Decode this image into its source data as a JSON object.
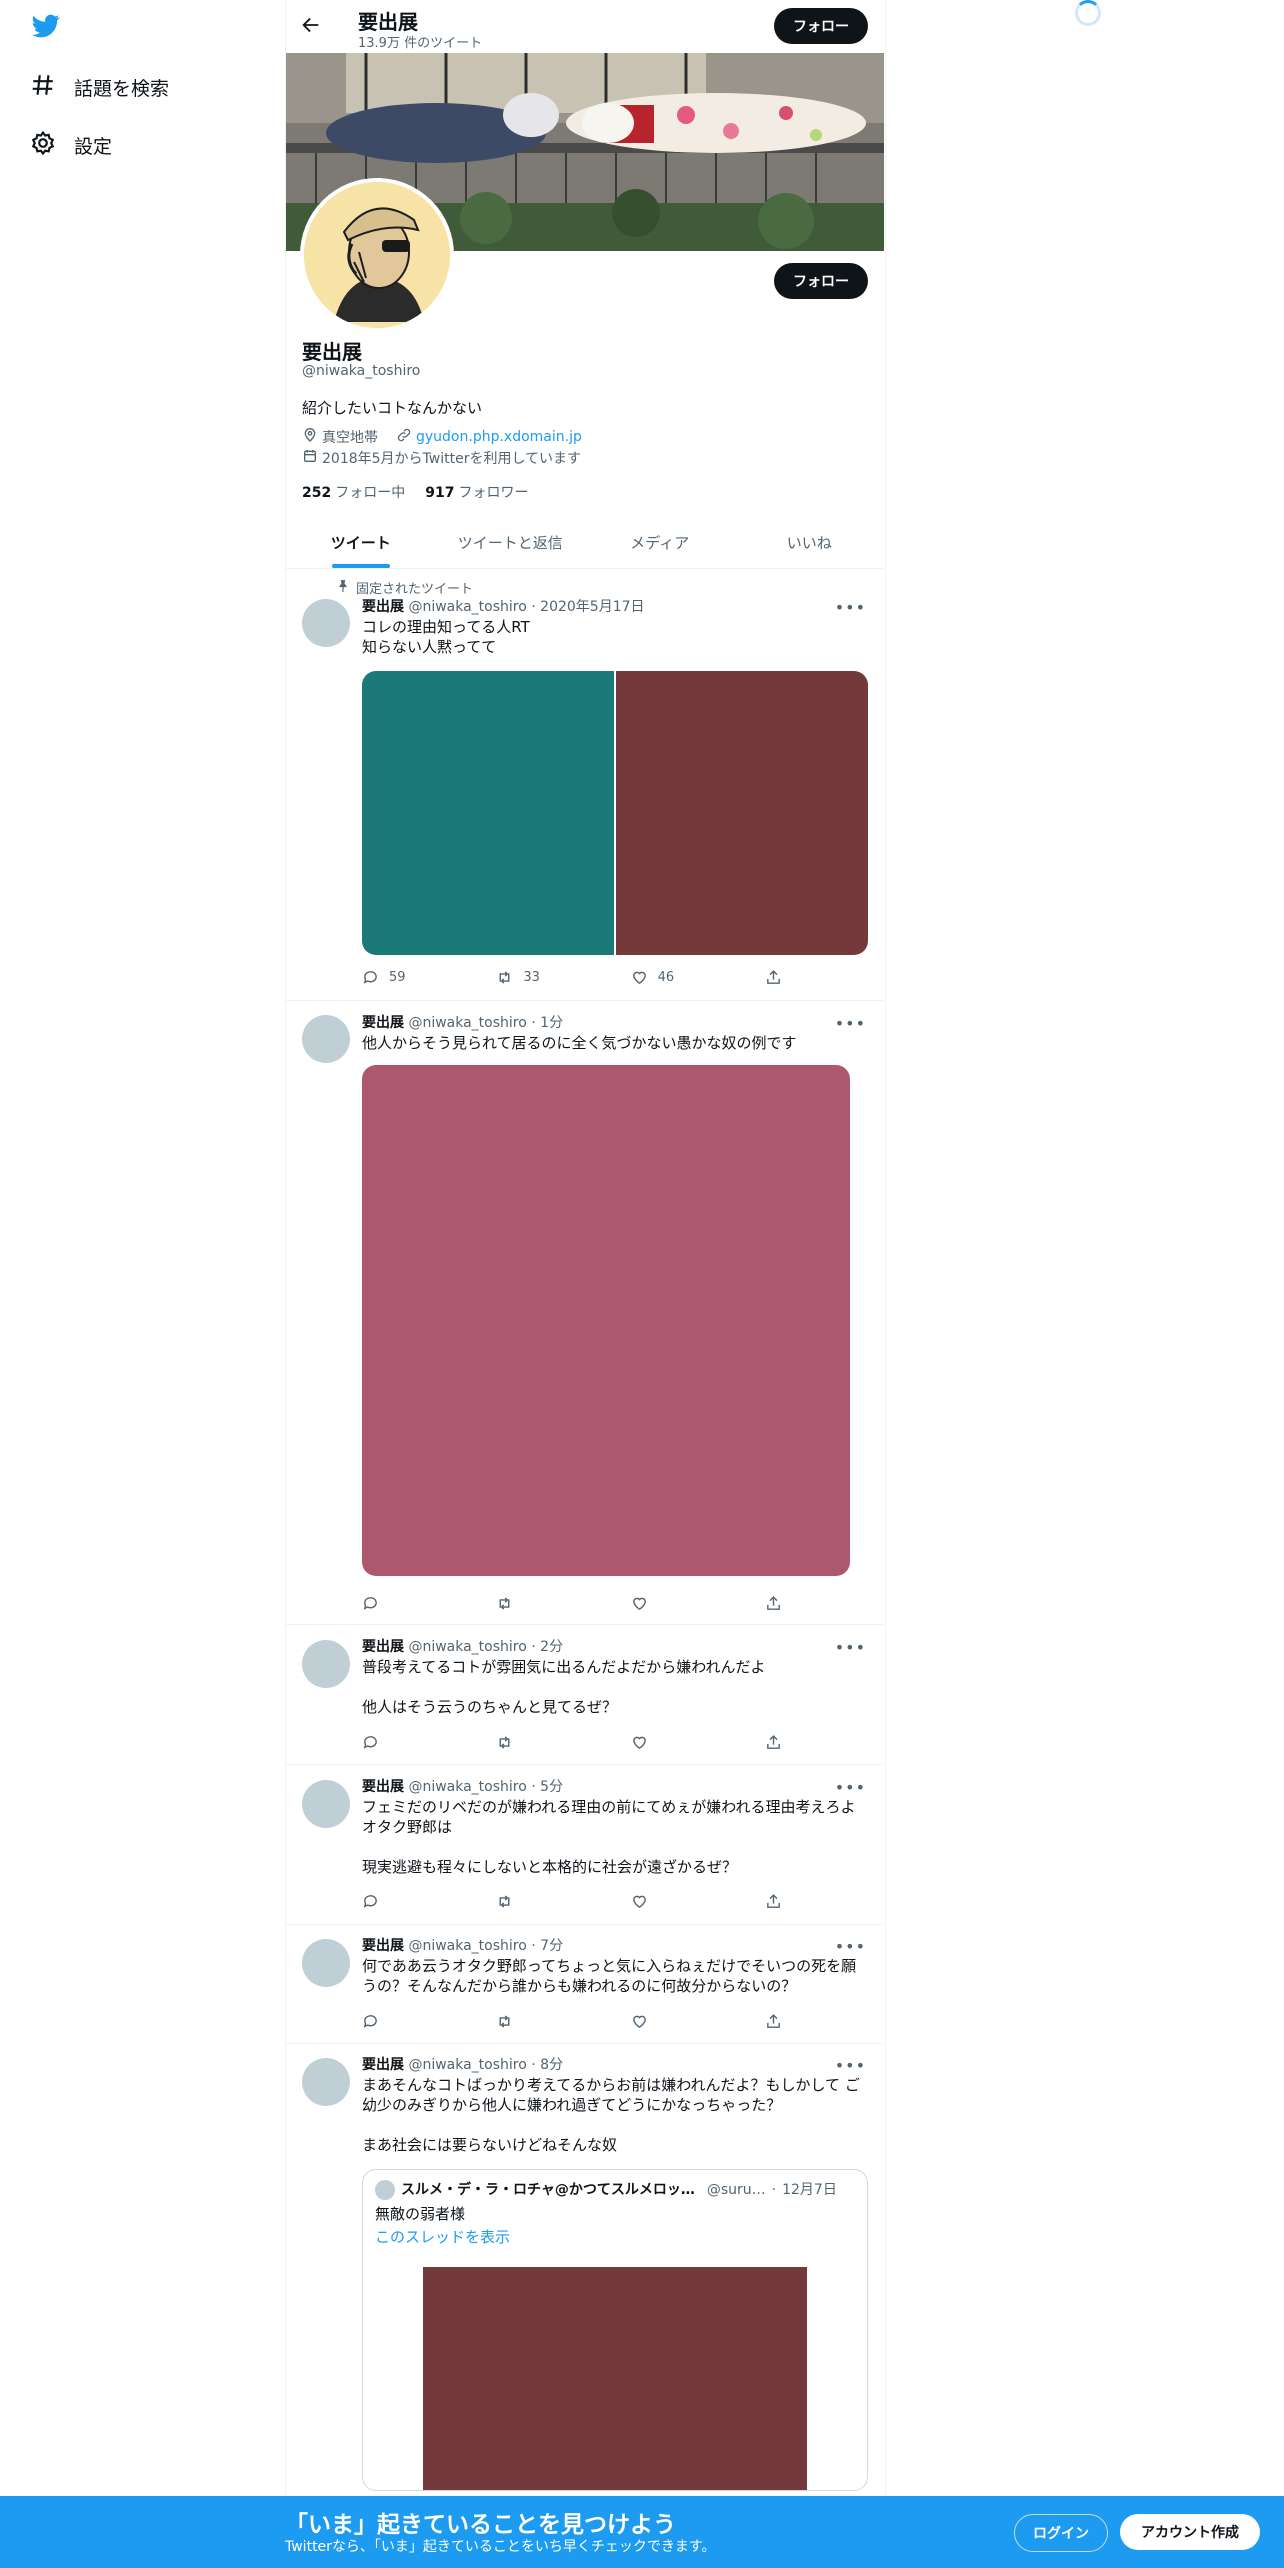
{
  "nav": {
    "logo_icon": "twitter-bird-icon",
    "items": [
      {
        "label": "話題を検索",
        "icon": "hashtag-icon"
      },
      {
        "label": "設定",
        "icon": "gear-icon"
      }
    ]
  },
  "header": {
    "name": "要出展",
    "tweet_count": "13.9万 件のツイート",
    "follow_label": "フォロー"
  },
  "profile": {
    "name": "要出展",
    "handle": "@niwaka_toshiro",
    "bio": "紹介したいコトなんかない",
    "location": "真空地帯",
    "website": "gyudon.php.xdomain.jp",
    "joined": "2018年5月からTwitterを利用しています",
    "following_count": "252",
    "following_label": "フォロー中",
    "followers_count": "917",
    "followers_label": "フォロワー",
    "follow_label": "フォロー"
  },
  "tabs": [
    "ツイート",
    "ツイートと返信",
    "メディア",
    "いいね"
  ],
  "pinned_label": "固定されたツイート",
  "tweets": [
    {
      "name": "要出展",
      "handle": "@niwaka_toshiro",
      "time": "2020年5月17日",
      "text": "コレの理由知ってる人RT\n知らない人黙ってて",
      "media_colors": [
        "#1a7a78",
        "#74393a"
      ],
      "replies": "59",
      "retweets": "33",
      "likes": "46"
    },
    {
      "name": "要出展",
      "handle": "@niwaka_toshiro",
      "time": "1分",
      "text": "他人からそう見られて居るのに全く気づかない愚かな奴の例です",
      "media_colors": [
        "#ad586c"
      ],
      "replies": "",
      "retweets": "",
      "likes": ""
    },
    {
      "name": "要出展",
      "handle": "@niwaka_toshiro",
      "time": "2分",
      "text": "普段考えてるコトが雰囲気に出るんだよだから嫌われんだよ\n\n他人はそう云うのちゃんと見てるぜ？",
      "replies": "",
      "retweets": "",
      "likes": ""
    },
    {
      "name": "要出展",
      "handle": "@niwaka_toshiro",
      "time": "5分",
      "text": "フェミだのリベだのが嫌われる理由の前にてめぇが嫌われる理由考えろよオタク野郎は\n\n現実逃避も程々にしないと本格的に社会が遠ざかるぜ？",
      "replies": "",
      "retweets": "",
      "likes": ""
    },
    {
      "name": "要出展",
      "handle": "@niwaka_toshiro",
      "time": "7分",
      "text": "何でああ云うオタク野郎ってちょっと気に入らねぇだけでそいつの死を願うの？そんなんだから誰からも嫌われるのに何故分からないの？",
      "replies": "",
      "retweets": "",
      "likes": ""
    },
    {
      "name": "要出展",
      "handle": "@niwaka_toshiro",
      "time": "8分",
      "text": "まあそんなコトばっかり考えてるからお前は嫌われんだよ？もしかして ご幼少のみぎりから他人に嫌われ過ぎてどうにかなっちゃった？\n\nまあ社会には要らないけどねそんな奴",
      "quote": {
        "name": "スルメ・デ・ラ・ロチャ@かつてスルメロッ…",
        "handle": "@suru…",
        "time": "12月7日",
        "text": "無敵の弱者様",
        "thread_link": "このスレッドを表示",
        "media_color": "#74393a"
      }
    }
  ],
  "bottom_bar": {
    "title": "「いま」起きていることを見つけよう",
    "subtitle": "Twitterなら、「いま」起きていることをいち早くチェックできます。",
    "login": "ログイン",
    "signup": "アカウント作成"
  },
  "colors": {
    "accent": "#1d9bf0",
    "text": "#0f1419",
    "muted": "#536471",
    "border": "#eff3f4"
  }
}
